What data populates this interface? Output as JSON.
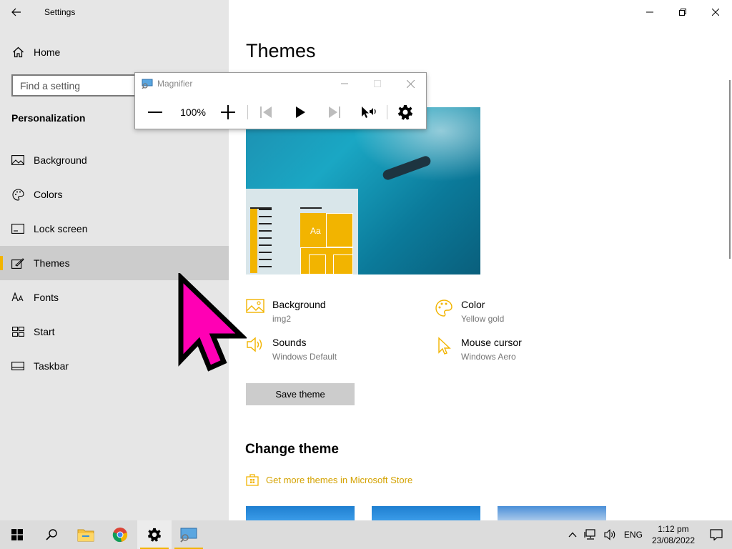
{
  "window": {
    "title": "Settings"
  },
  "sidebar": {
    "home_label": "Home",
    "search_placeholder": "Find a setting",
    "section_heading": "Personalization",
    "items": [
      {
        "label": "Background",
        "icon": "image-icon",
        "active": false
      },
      {
        "label": "Colors",
        "icon": "palette-icon",
        "active": false
      },
      {
        "label": "Lock screen",
        "icon": "lock-screen-icon",
        "active": false
      },
      {
        "label": "Themes",
        "icon": "brush-icon",
        "active": true
      },
      {
        "label": "Fonts",
        "icon": "fonts-icon",
        "active": false
      },
      {
        "label": "Start",
        "icon": "start-icon",
        "active": false
      },
      {
        "label": "Taskbar",
        "icon": "taskbar-icon",
        "active": false
      }
    ]
  },
  "main": {
    "page_title": "Themes",
    "preview": {
      "tile_text": "Aa"
    },
    "properties": {
      "background": {
        "name": "Background",
        "value": "img2"
      },
      "color": {
        "name": "Color",
        "value": "Yellow gold"
      },
      "sounds": {
        "name": "Sounds",
        "value": "Windows Default"
      },
      "mouse_cursor": {
        "name": "Mouse cursor",
        "value": "Windows Aero"
      }
    },
    "save_button": "Save theme",
    "change_theme_heading": "Change theme",
    "store_link": "Get more themes in Microsoft Store"
  },
  "magnifier": {
    "title": "Magnifier",
    "zoom": "100%"
  },
  "taskbar": {
    "language": "ENG",
    "time": "1:12 pm",
    "date": "23/08/2022"
  },
  "colors": {
    "accent": "#f2b400",
    "pointer": "#ff00b4",
    "sidebar_bg": "#e6e6e6"
  }
}
